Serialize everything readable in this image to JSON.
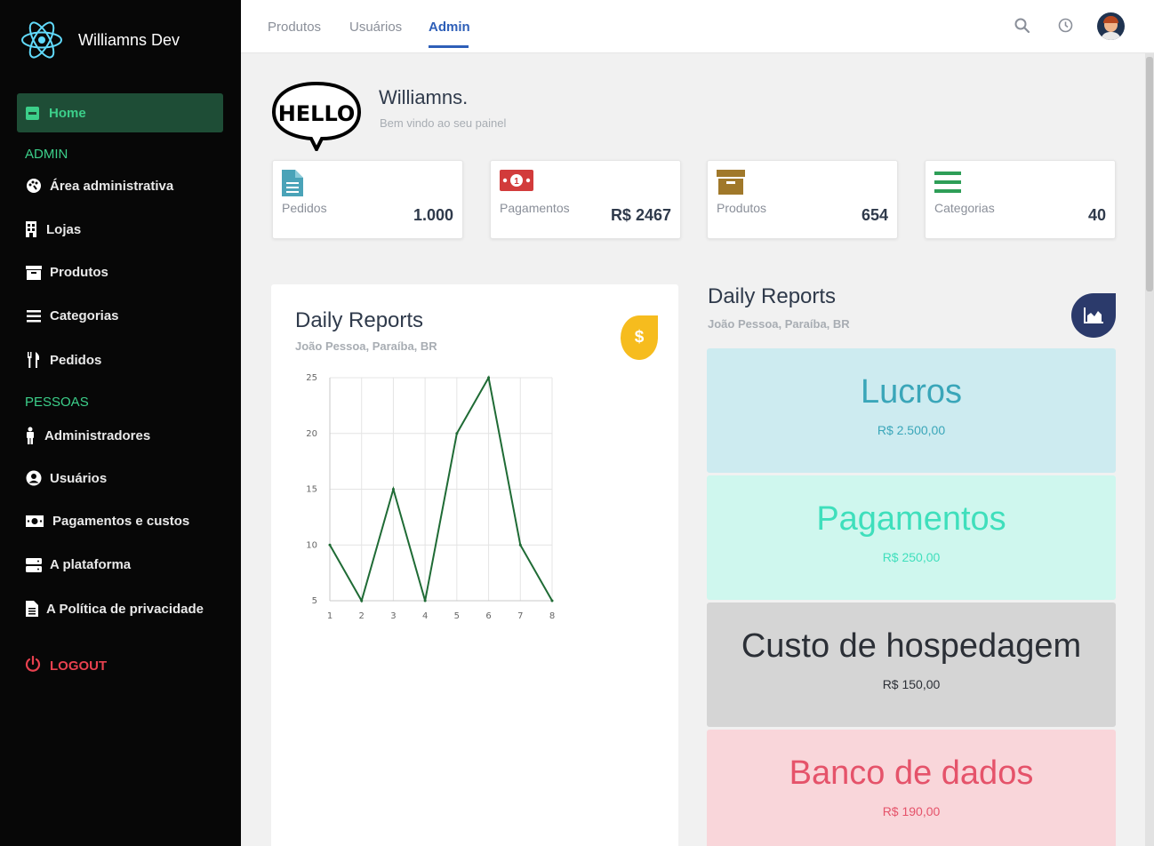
{
  "brand": {
    "name": "Williamns Dev"
  },
  "sidebar": {
    "home": "Home",
    "section_admin": "ADMIN",
    "section_pessoas": "PESSOAS",
    "items": [
      {
        "label": "Área administrativa",
        "icon": "palette-icon"
      },
      {
        "label": "Lojas",
        "icon": "building-icon"
      },
      {
        "label": "Produtos",
        "icon": "archive-icon"
      },
      {
        "label": "Categorias",
        "icon": "list-icon"
      },
      {
        "label": "Pedidos",
        "icon": "utensils-icon"
      },
      {
        "label": "Administradores",
        "icon": "person-icon"
      },
      {
        "label": "Usuários",
        "icon": "user-circle-icon"
      },
      {
        "label": "Pagamentos e custos",
        "icon": "money-icon"
      },
      {
        "label": "A plataforma",
        "icon": "server-icon"
      },
      {
        "label": "A Política de privacidade",
        "icon": "file-icon"
      }
    ],
    "logout": "LOGOUT"
  },
  "topbar": {
    "tabs": [
      "Produtos",
      "Usuários",
      "Admin"
    ],
    "active_tab": "Admin"
  },
  "greeting": {
    "hello_text": "HELLO",
    "name": "Williamns.",
    "subtitle": "Bem vindo ao seu painel"
  },
  "stats": [
    {
      "label": "Pedidos",
      "value": "1.000",
      "color": "#4aa3b8",
      "icon": "document-icon"
    },
    {
      "label": "Pagamentos",
      "value": "R$ 2467",
      "color": "#d23b3b",
      "icon": "money-bill-icon"
    },
    {
      "label": "Produtos",
      "value": "654",
      "color": "#a0782a",
      "icon": "archive-icon"
    },
    {
      "label": "Categorias",
      "value": "40",
      "color": "#2e9e57",
      "icon": "list-icon"
    }
  ],
  "report_left": {
    "title": "Daily Reports",
    "subtitle": "João Pessoa, Paraíba, BR",
    "badge": "$"
  },
  "chart_data": {
    "type": "line",
    "title": "",
    "x": [
      1,
      2,
      3,
      4,
      5,
      6,
      7,
      8
    ],
    "series": [
      {
        "values": [
          10,
          5,
          15,
          5,
          20,
          25,
          10,
          5
        ],
        "color": "#1f6b35"
      }
    ],
    "xlabel": "",
    "ylabel": "",
    "xlim": [
      1,
      8
    ],
    "ylim": [
      5,
      25
    ],
    "yticks": [
      5,
      10,
      15,
      20,
      25
    ],
    "grid": true
  },
  "report_right": {
    "title": "Daily Reports",
    "subtitle": "João Pessoa, Paraíba, BR",
    "badge_icon": "chart-area-icon",
    "panels": [
      {
        "title": "Lucros",
        "value": "R$ 2.500,00",
        "bg": "#cdebf0",
        "color": "#3aa6b9"
      },
      {
        "title": "Pagamentos",
        "value": "R$ 250,00",
        "bg": "#cff7ee",
        "color": "#3fdfbc"
      },
      {
        "title": "Custo de hospedagem",
        "value": "R$ 150,00",
        "bg": "#d5d5d5",
        "color": "#2b2f36"
      },
      {
        "title": "Banco de dados",
        "value": "R$ 190,00",
        "bg": "#f9d6da",
        "color": "#e5536a"
      }
    ]
  }
}
